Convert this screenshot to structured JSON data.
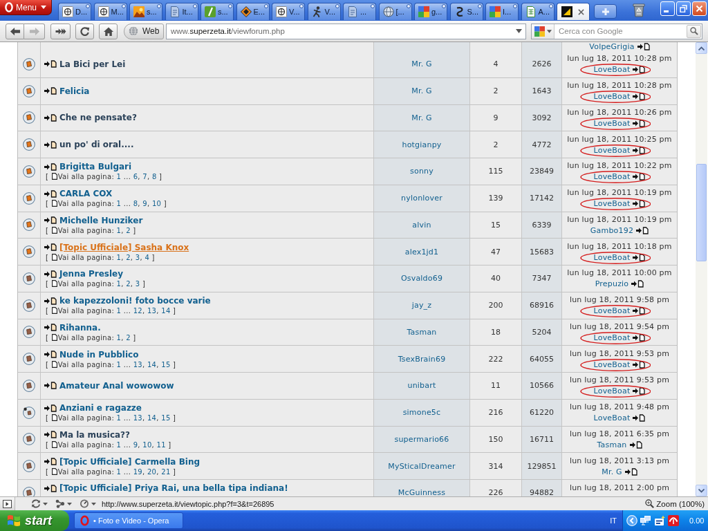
{
  "browser": {
    "menu_button": "Menu",
    "tabs": [
      {
        "title": "D...",
        "kind": "wiki",
        "selected": false
      },
      {
        "title": "M...",
        "kind": "wiki",
        "selected": false
      },
      {
        "title": "s...",
        "kind": "landscape",
        "selected": false
      },
      {
        "title": "It...",
        "kind": "doc",
        "selected": false
      },
      {
        "title": "s...",
        "kind": "pen",
        "selected": false
      },
      {
        "title": "E...",
        "kind": "diamond",
        "selected": false
      },
      {
        "title": "V...",
        "kind": "wiki",
        "selected": false
      },
      {
        "title": "V...",
        "kind": "figure",
        "selected": false
      },
      {
        "title": "...",
        "kind": "doc",
        "selected": false
      },
      {
        "title": "[...",
        "kind": "globe",
        "selected": false
      },
      {
        "title": "g...",
        "kind": "quad",
        "selected": false
      },
      {
        "title": "S...",
        "kind": "swirl",
        "selected": false
      },
      {
        "title": "I...",
        "kind": "quad",
        "selected": false
      },
      {
        "title": "A...",
        "kind": "sheet",
        "selected": false
      },
      {
        "kind": "tile",
        "selected": true
      }
    ],
    "nav_buttons": [
      {
        "kind": "back",
        "disabled": false
      },
      {
        "kind": "forward",
        "disabled": true
      },
      {
        "kind": "fast_forward",
        "disabled": false
      },
      {
        "kind": "reload",
        "disabled": false
      },
      {
        "kind": "home",
        "disabled": false
      }
    ],
    "site_badge": "Web",
    "url": {
      "prefix": "www.",
      "domain": "superzeta.it",
      "path": "/viewforum.php"
    },
    "search": {
      "placeholder": "Cerca con Google"
    }
  },
  "forum": {
    "partial_row": {
      "last_author": "VolpeGrigia"
    },
    "topics": [
      {
        "title": "La Bici per Lei",
        "visited": true,
        "hovered": false,
        "unread": true,
        "own_post": false,
        "author": "Mr. G",
        "replies": "4",
        "views": "2626",
        "last_post": {
          "date": "lun lug 18, 2011 10:28 pm",
          "author": "LoveBoat",
          "circled": true
        }
      },
      {
        "title": "Felicia",
        "visited": false,
        "hovered": false,
        "unread": true,
        "own_post": false,
        "author": "Mr. G",
        "replies": "2",
        "views": "1643",
        "last_post": {
          "date": "lun lug 18, 2011 10:28 pm",
          "author": "LoveBoat",
          "circled": true
        }
      },
      {
        "title": "Che ne pensate?",
        "visited": true,
        "hovered": false,
        "unread": true,
        "own_post": false,
        "author": "Mr. G",
        "replies": "9",
        "views": "3092",
        "last_post": {
          "date": "lun lug 18, 2011 10:26 pm",
          "author": "LoveBoat",
          "circled": true
        }
      },
      {
        "title": "un po' di oral....",
        "visited": true,
        "hovered": false,
        "unread": true,
        "own_post": false,
        "author": "hotgianpy",
        "replies": "2",
        "views": "4772",
        "last_post": {
          "date": "lun lug 18, 2011 10:25 pm",
          "author": "LoveBoat",
          "circled": true
        }
      },
      {
        "title": "Brigitta Bulgari",
        "visited": false,
        "hovered": false,
        "unread": true,
        "own_post": false,
        "pagination": {
          "open": "[",
          "label": "Vai alla pagina:",
          "pages": [
            "1",
            " ... ",
            "6",
            ", ",
            "7",
            ", ",
            "8"
          ],
          "close": "]"
        },
        "author": "sonny",
        "replies": "115",
        "views": "23849",
        "last_post": {
          "date": "lun lug 18, 2011 10:22 pm",
          "author": "LoveBoat",
          "circled": true
        }
      },
      {
        "title": "CARLA COX",
        "visited": false,
        "hovered": false,
        "unread": true,
        "own_post": false,
        "pagination": {
          "open": "[",
          "label": "Vai alla pagina:",
          "pages": [
            "1",
            " ... ",
            "8",
            ", ",
            "9",
            ", ",
            "10"
          ],
          "close": "]"
        },
        "author": "nylonlover",
        "replies": "139",
        "views": "17142",
        "last_post": {
          "date": "lun lug 18, 2011 10:19 pm",
          "author": "LoveBoat",
          "circled": true
        }
      },
      {
        "title": "Michelle Hunziker",
        "visited": false,
        "hovered": false,
        "unread": true,
        "own_post": false,
        "pagination": {
          "open": "[",
          "label": "Vai alla pagina:",
          "pages": [
            "1",
            ", ",
            "2"
          ],
          "close": "]"
        },
        "author": "alvin",
        "replies": "15",
        "views": "6339",
        "last_post": {
          "date": "lun lug 18, 2011 10:19 pm",
          "author": "Gambo192",
          "circled": false
        }
      },
      {
        "title": "[Topic Ufficiale] Sasha Knox",
        "visited": false,
        "hovered": true,
        "unread": true,
        "own_post": false,
        "pagination": {
          "open": "[",
          "label": "Vai alla pagina:",
          "pages": [
            "1",
            ", ",
            "2",
            ", ",
            "3",
            ", ",
            "4"
          ],
          "close": "]"
        },
        "author": "alex1jd1",
        "replies": "47",
        "views": "15683",
        "last_post": {
          "date": "lun lug 18, 2011 10:18 pm",
          "author": "LoveBoat",
          "circled": true
        }
      },
      {
        "title": "Jenna Presley",
        "visited": false,
        "hovered": false,
        "unread": false,
        "own_post": false,
        "pagination": {
          "open": "[",
          "label": "Vai alla pagina:",
          "pages": [
            "1",
            ", ",
            "2",
            ", ",
            "3"
          ],
          "close": "]"
        },
        "author": "Osvaldo69",
        "replies": "40",
        "views": "7347",
        "last_post": {
          "date": "lun lug 18, 2011 10:00 pm",
          "author": "Prepuzio",
          "circled": false
        }
      },
      {
        "title": "ke kapezzoloni! foto bocce varie",
        "visited": false,
        "hovered": false,
        "unread": false,
        "own_post": false,
        "pagination": {
          "open": "[",
          "label": "Vai alla pagina:",
          "pages": [
            "1",
            " ... ",
            "12",
            ", ",
            "13",
            ", ",
            "14"
          ],
          "close": "]"
        },
        "author": "jay_z",
        "replies": "200",
        "views": "68916",
        "last_post": {
          "date": "lun lug 18, 2011 9:58 pm",
          "author": "LoveBoat",
          "circled": true
        }
      },
      {
        "title": "Rihanna.",
        "visited": false,
        "hovered": false,
        "unread": false,
        "own_post": false,
        "pagination": {
          "open": "[",
          "label": "Vai alla pagina:",
          "pages": [
            "1",
            ", ",
            "2"
          ],
          "close": "]"
        },
        "author": "Tasman",
        "replies": "18",
        "views": "5204",
        "last_post": {
          "date": "lun lug 18, 2011 9:54 pm",
          "author": "LoveBoat",
          "circled": true
        }
      },
      {
        "title": "Nude in Pubblico",
        "visited": false,
        "hovered": false,
        "unread": false,
        "own_post": false,
        "pagination": {
          "open": "[",
          "label": "Vai alla pagina:",
          "pages": [
            "1",
            " ... ",
            "13",
            ", ",
            "14",
            ", ",
            "15"
          ],
          "close": "]"
        },
        "author": "TsexBrain69",
        "replies": "222",
        "views": "64055",
        "last_post": {
          "date": "lun lug 18, 2011 9:53 pm",
          "author": "LoveBoat",
          "circled": true
        }
      },
      {
        "title": "Amateur Anal wowowow",
        "visited": false,
        "hovered": false,
        "unread": false,
        "own_post": false,
        "author": "unibart",
        "replies": "11",
        "views": "10566",
        "last_post": {
          "date": "lun lug 18, 2011 9:53 pm",
          "author": "LoveBoat",
          "circled": true
        }
      },
      {
        "title": "Anziani e ragazze",
        "visited": false,
        "hovered": false,
        "unread": false,
        "own_post": true,
        "pagination": {
          "open": "[",
          "label": "Vai alla pagina:",
          "pages": [
            "1",
            " ... ",
            "13",
            ", ",
            "14",
            ", ",
            "15"
          ],
          "close": "]"
        },
        "author": "simone5c",
        "replies": "216",
        "views": "61220",
        "last_post": {
          "date": "lun lug 18, 2011 9:48 pm",
          "author": "LoveBoat",
          "circled": false
        }
      },
      {
        "title": "Ma la musica??",
        "visited": true,
        "hovered": false,
        "unread": false,
        "own_post": false,
        "pagination": {
          "open": "[",
          "label": "Vai alla pagina:",
          "pages": [
            "1",
            " ... ",
            "9",
            ", ",
            "10",
            ", ",
            "11"
          ],
          "close": "]"
        },
        "author": "supermario66",
        "replies": "150",
        "views": "16711",
        "last_post": {
          "date": "lun lug 18, 2011 6:35 pm",
          "author": "Tasman",
          "circled": false
        }
      },
      {
        "title": "[Topic Ufficiale] Carmella Bing",
        "visited": false,
        "hovered": false,
        "unread": false,
        "own_post": false,
        "pagination": {
          "open": "[",
          "label": "Vai alla pagina:",
          "pages": [
            "1",
            " ... ",
            "19",
            ", ",
            "20",
            ", ",
            "21"
          ],
          "close": "]"
        },
        "author": "MySticalDreamer",
        "replies": "314",
        "views": "129851",
        "last_post": {
          "date": "lun lug 18, 2011 3:13 pm",
          "author": "Mr. G",
          "circled": false
        }
      },
      {
        "title": "[Topic Ufficiale] Priya Rai, una bella tipa indiana!",
        "visited": false,
        "hovered": false,
        "unread": false,
        "own_post": false,
        "author": "McGuinness",
        "replies": "226",
        "views": "94882",
        "last_post": {
          "date": "lun lug 18, 2011 2:00 pm"
        }
      }
    ]
  },
  "status_bar": {
    "link_url": "http://www.superzeta.it/viewtopic.php?f=3&t=26895",
    "zoom": "Zoom (100%)"
  },
  "taskbar": {
    "start": "start",
    "tasks": [
      {
        "title": "• Foto e Video - Opera",
        "selected": false
      }
    ],
    "language": "IT",
    "clock": "0.00"
  }
}
